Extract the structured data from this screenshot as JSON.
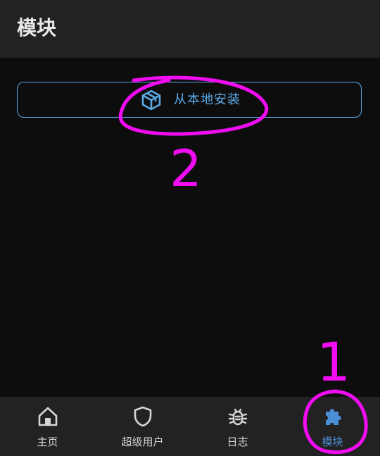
{
  "app_bar": {
    "title": "模块"
  },
  "main": {
    "install_button": {
      "label": "从本地安装",
      "icon": "package-box-icon"
    }
  },
  "bottom_nav": {
    "items": [
      {
        "label": "主页",
        "icon": "home-icon",
        "active": false
      },
      {
        "label": "超级用户",
        "icon": "shield-icon",
        "active": false
      },
      {
        "label": "日志",
        "icon": "bug-icon",
        "active": false
      },
      {
        "label": "模块",
        "icon": "puzzle-piece-icon",
        "active": true
      }
    ]
  },
  "annotations": {
    "step_one": "1",
    "step_two": "2"
  },
  "colors": {
    "accent": "#5aa9e6",
    "active_nav": "#4b8fd6",
    "annotation": "#f20cf2",
    "background": "#0d0d0e",
    "bar": "#222223"
  }
}
